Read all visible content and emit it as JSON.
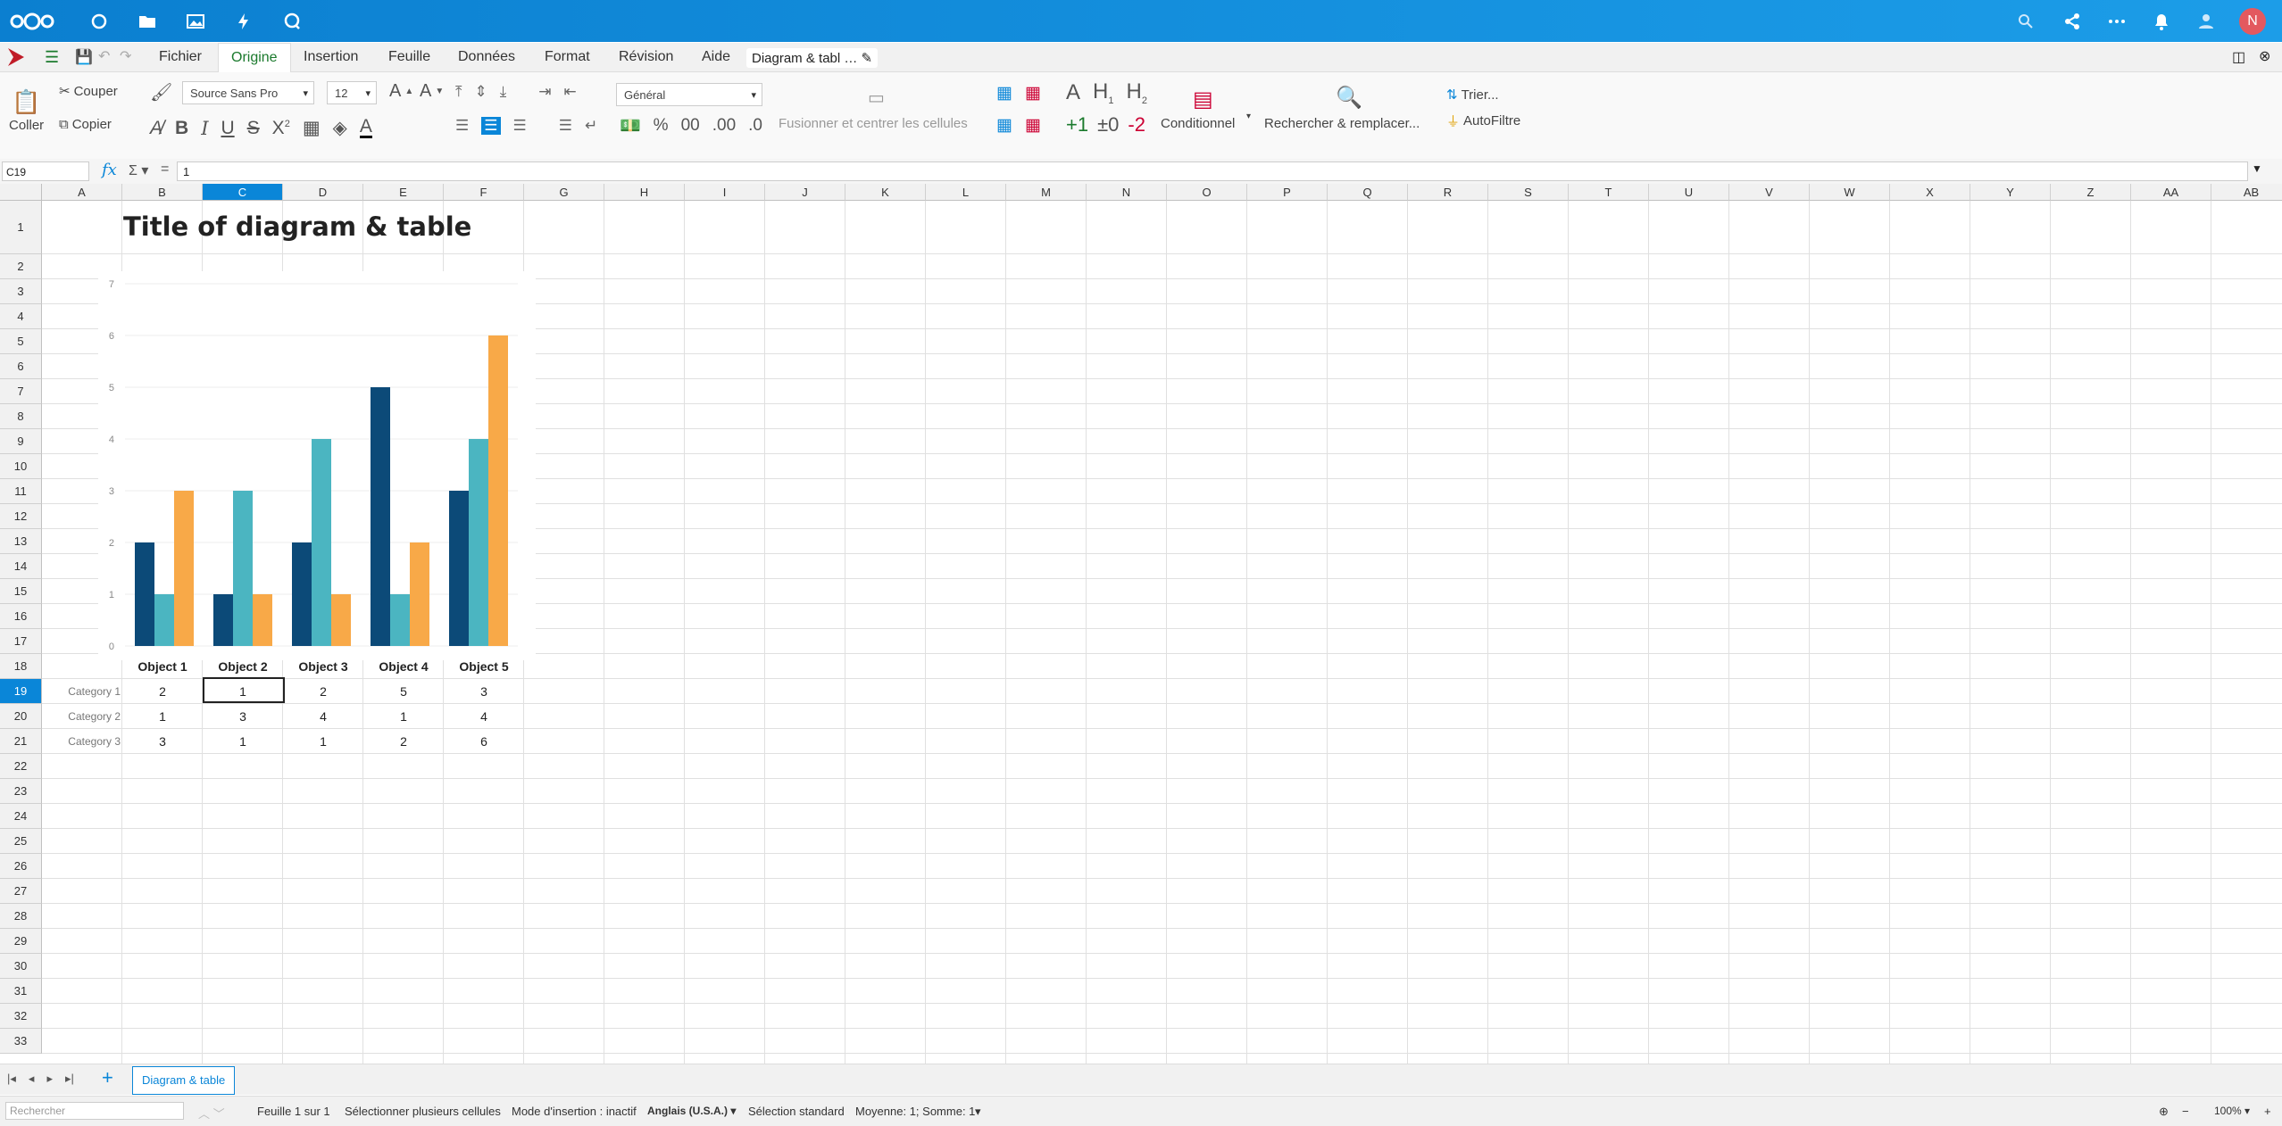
{
  "app": {
    "menu": [
      "Fichier",
      "Origine",
      "Insertion",
      "Feuille",
      "Données",
      "Format",
      "Révision",
      "Aide"
    ],
    "active_menu": "Origine",
    "doc_title": "Diagram & tabl …",
    "avatar_letter": "N",
    "accent": "#0a86d8"
  },
  "ribbon": {
    "paste": "Coller",
    "cut": "Couper",
    "copy": "Copier",
    "font_name": "Source Sans Pro",
    "font_size": "12",
    "number_format": "Général",
    "merge": "Fusionner et centrer les cellules",
    "conditional": "Conditionnel",
    "find_replace": "Rechercher & remplacer...",
    "sort": "Trier...",
    "autofilter": "AutoFiltre"
  },
  "formula": {
    "cell_ref": "C19",
    "value": "1",
    "fx_label": "fx",
    "equals": "="
  },
  "columns": [
    "A",
    "B",
    "C",
    "D",
    "E",
    "F",
    "G",
    "H",
    "I",
    "J",
    "K",
    "L",
    "M",
    "N",
    "O",
    "P",
    "Q",
    "R",
    "S",
    "T",
    "U",
    "V",
    "W",
    "X",
    "Y",
    "Z",
    "AA",
    "AB"
  ],
  "rows": [
    "1",
    "2",
    "3",
    "4",
    "5",
    "6",
    "7",
    "8",
    "9",
    "10",
    "11",
    "12",
    "13",
    "14",
    "15",
    "16",
    "17",
    "18",
    "19",
    "20",
    "21",
    "22",
    "23",
    "24",
    "25",
    "26",
    "27",
    "28",
    "29",
    "30",
    "31",
    "32",
    "33"
  ],
  "sheet": {
    "title": "Title of diagram & table",
    "headers": [
      "Object 1",
      "Object 2",
      "Object 3",
      "Object 4",
      "Object 5"
    ],
    "table": [
      {
        "label": "Category 1",
        "values": [
          "2",
          "1",
          "2",
          "5",
          "3"
        ]
      },
      {
        "label": "Category 2",
        "values": [
          "1",
          "3",
          "4",
          "1",
          "4"
        ]
      },
      {
        "label": "Category 3",
        "values": [
          "3",
          "1",
          "1",
          "2",
          "6"
        ]
      }
    ]
  },
  "chart_data": {
    "type": "bar",
    "categories": [
      "Object 1",
      "Object 2",
      "Object 3",
      "Object 4",
      "Object 5"
    ],
    "series": [
      {
        "values": [
          2,
          1,
          2,
          5,
          3
        ],
        "color": "#0c4a78"
      },
      {
        "values": [
          1,
          3,
          4,
          1,
          4
        ],
        "color": "#4bb5c1"
      },
      {
        "values": [
          3,
          1,
          1,
          2,
          6
        ],
        "color": "#f8a948"
      }
    ],
    "ylim": [
      0,
      7
    ],
    "yticks": [
      "0",
      "1",
      "2",
      "3",
      "4",
      "5",
      "6",
      "7"
    ],
    "grid": true,
    "legend": "none"
  },
  "sheet_tabs": [
    "Diagram & table"
  ],
  "status": {
    "search_placeholder": "Rechercher",
    "sheet_pos": "Feuille 1 sur 1",
    "multi_select": "Sélectionner plusieurs cellules",
    "insert_mode": "Mode d'insertion : inactif",
    "language": "Anglais (U.S.A.)",
    "selection": "Sélection standard",
    "sum": "Moyenne: 1; Somme: 1",
    "zoom": "100%"
  }
}
